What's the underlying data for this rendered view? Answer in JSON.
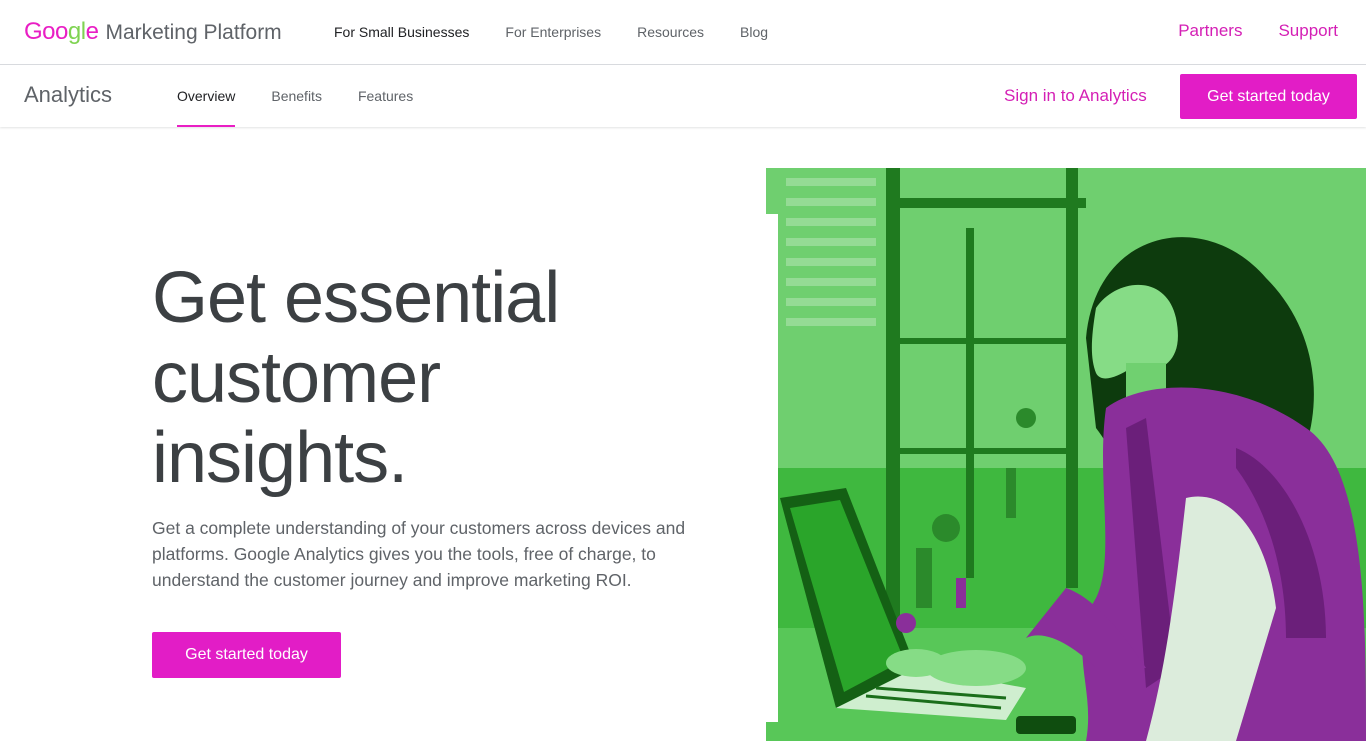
{
  "brand": {
    "google_letters": [
      "G",
      "o",
      "o",
      "g",
      "l",
      "e"
    ],
    "product": "Marketing Platform"
  },
  "top_nav": {
    "items": [
      {
        "label": "For Small Businesses"
      },
      {
        "label": "For Enterprises"
      },
      {
        "label": "Resources"
      },
      {
        "label": "Blog"
      }
    ],
    "right": {
      "partners": "Partners",
      "support": "Support"
    }
  },
  "sub_nav": {
    "title": "Analytics",
    "tabs": [
      {
        "label": "Overview"
      },
      {
        "label": "Benefits"
      },
      {
        "label": "Features"
      }
    ],
    "sign_in": "Sign in to Analytics",
    "cta": "Get started today"
  },
  "hero": {
    "title_lines": [
      "Get essential",
      "customer",
      "insights."
    ],
    "body": "Get a complete understanding of your customers across devices and platforms. Google Analytics gives you the tools, free of charge, to understand the customer journey and improve marketing ROI.",
    "cta": "Get started today"
  },
  "colors": {
    "accent": "#e21dc6",
    "link": "#d41fb5",
    "image_green": "#2aa52a",
    "image_purple": "#8a2f9a"
  }
}
